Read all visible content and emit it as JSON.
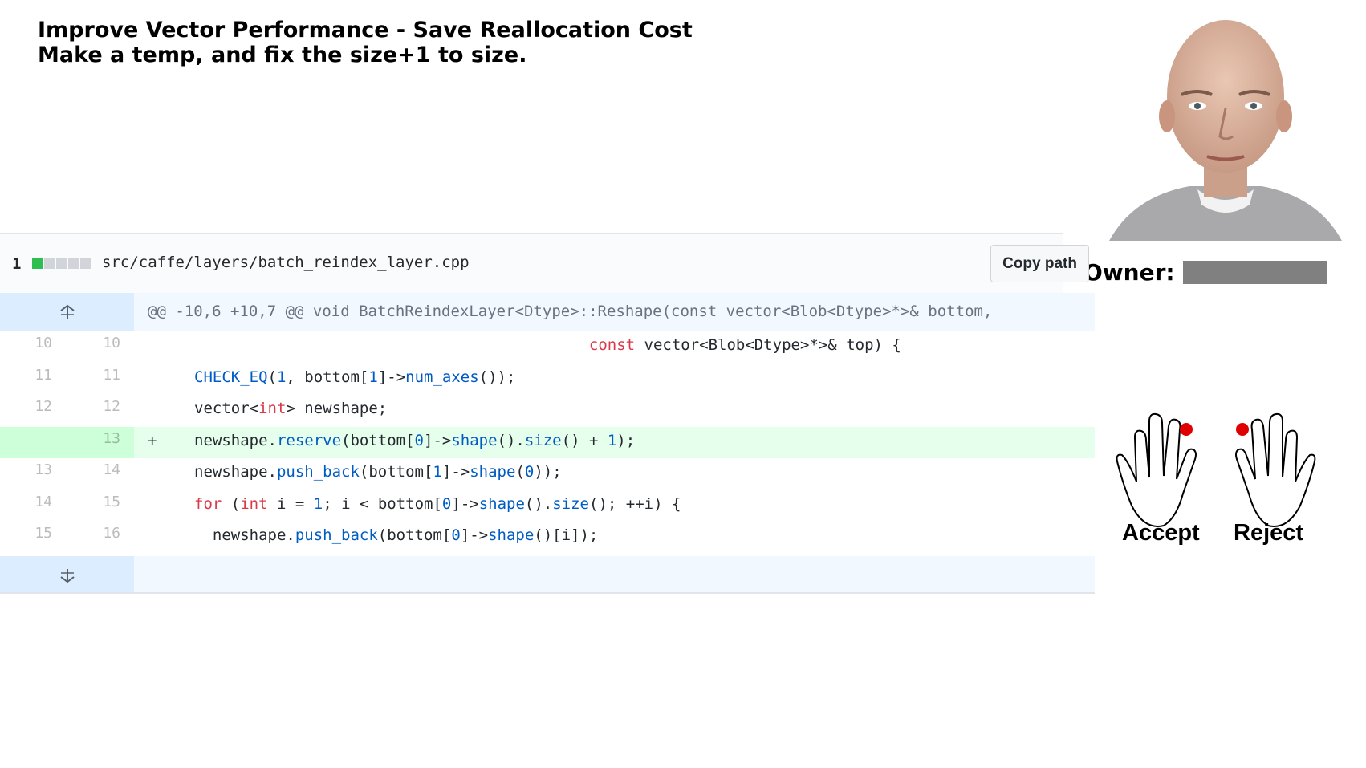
{
  "title": {
    "line1": "Improve Vector Performance - Save Reallocation Cost",
    "line2": "Make a temp, and fix the size+1 to size."
  },
  "owner": {
    "label": "Owner:"
  },
  "file": {
    "changed_count": "1",
    "path": "src/caffe/layers/batch_reindex_layer.cpp",
    "copy_button": "Copy path"
  },
  "hunk_header": "@@ -10,6 +10,7 @@ void BatchReindexLayer<Dtype>::Reshape(const vector<Blob<Dtype>*>& bottom,",
  "lines": [
    {
      "old": "10",
      "new": "10",
      "marker": "",
      "added": false
    },
    {
      "old": "11",
      "new": "11",
      "marker": "",
      "added": false
    },
    {
      "old": "12",
      "new": "12",
      "marker": "",
      "added": false
    },
    {
      "old": "",
      "new": "13",
      "marker": "+",
      "added": true
    },
    {
      "old": "13",
      "new": "14",
      "marker": "",
      "added": false
    },
    {
      "old": "14",
      "new": "15",
      "marker": "",
      "added": false
    },
    {
      "old": "15",
      "new": "16",
      "marker": "",
      "added": false
    }
  ],
  "code": [
    [
      {
        "t": "                                           "
      },
      {
        "t": "const",
        "c": "k"
      },
      {
        "t": " vector<Blob<Dtype>*>& top) {"
      }
    ],
    [
      {
        "t": "CHECK_EQ",
        "c": "f"
      },
      {
        "t": "("
      },
      {
        "t": "1",
        "c": "n"
      },
      {
        "t": ", bottom["
      },
      {
        "t": "1",
        "c": "n"
      },
      {
        "t": "]->"
      },
      {
        "t": "num_axes",
        "c": "f"
      },
      {
        "t": "());"
      }
    ],
    [
      {
        "t": "vector<"
      },
      {
        "t": "int",
        "c": "k"
      },
      {
        "t": "> newshape;"
      }
    ],
    [
      {
        "t": "newshape."
      },
      {
        "t": "reserve",
        "c": "f"
      },
      {
        "t": "(bottom["
      },
      {
        "t": "0",
        "c": "n"
      },
      {
        "t": "]->"
      },
      {
        "t": "shape",
        "c": "f"
      },
      {
        "t": "()."
      },
      {
        "t": "size",
        "c": "f"
      },
      {
        "t": "() + "
      },
      {
        "t": "1",
        "c": "n"
      },
      {
        "t": ");"
      }
    ],
    [
      {
        "t": "newshape."
      },
      {
        "t": "push_back",
        "c": "f"
      },
      {
        "t": "(bottom["
      },
      {
        "t": "1",
        "c": "n"
      },
      {
        "t": "]->"
      },
      {
        "t": "shape",
        "c": "f"
      },
      {
        "t": "("
      },
      {
        "t": "0",
        "c": "n"
      },
      {
        "t": "));"
      }
    ],
    [
      {
        "t": "for",
        "c": "k"
      },
      {
        "t": " ("
      },
      {
        "t": "int",
        "c": "k"
      },
      {
        "t": " i = "
      },
      {
        "t": "1",
        "c": "n"
      },
      {
        "t": "; i < bottom["
      },
      {
        "t": "0",
        "c": "n"
      },
      {
        "t": "]->"
      },
      {
        "t": "shape",
        "c": "f"
      },
      {
        "t": "()."
      },
      {
        "t": "size",
        "c": "f"
      },
      {
        "t": "(); ++i) {"
      }
    ],
    [
      {
        "t": "  newshape."
      },
      {
        "t": "push_back",
        "c": "f"
      },
      {
        "t": "(bottom["
      },
      {
        "t": "0",
        "c": "n"
      },
      {
        "t": "]->"
      },
      {
        "t": "shape",
        "c": "f"
      },
      {
        "t": "()[i]);"
      }
    ]
  ],
  "hands": {
    "accept_label": "Accept",
    "reject_label": "Reject"
  },
  "colors": {
    "added_bg": "#e6ffed",
    "hunk_bg": "#f1f8ff",
    "keyword": "#d73a49",
    "function": "#005cc5",
    "marker_dot": "#e00000"
  },
  "icons": [
    "expand-up-icon",
    "expand-down-icon",
    "left-hand-icon",
    "right-hand-icon"
  ]
}
